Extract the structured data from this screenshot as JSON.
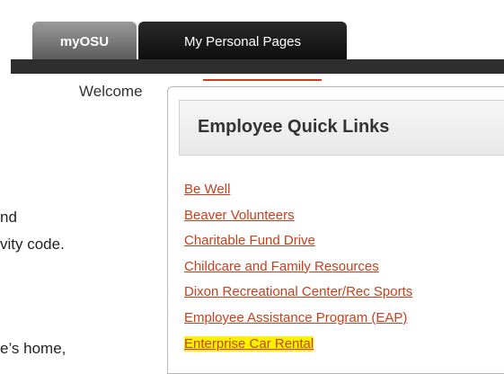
{
  "tabs": [
    {
      "label": "myOSU"
    },
    {
      "label": "My Personal Pages"
    }
  ],
  "welcome_text": "Welcome",
  "panel": {
    "title": "Employee Quick Links",
    "links": [
      "Be Well",
      "Beaver Volunteers",
      "Charitable Fund Drive",
      "Childcare and Family Resources",
      "Dixon Recreational Center/Rec Sports",
      "Employee Assistance Program (EAP)",
      "Enterprise Car Rental"
    ],
    "highlighted_link": "Enterprise Car Rental",
    "highlight_color": "#fff200",
    "link_color": "#c8401b"
  },
  "background_text": [
    "nd",
    "vity code.",
    "e’s home,"
  ]
}
